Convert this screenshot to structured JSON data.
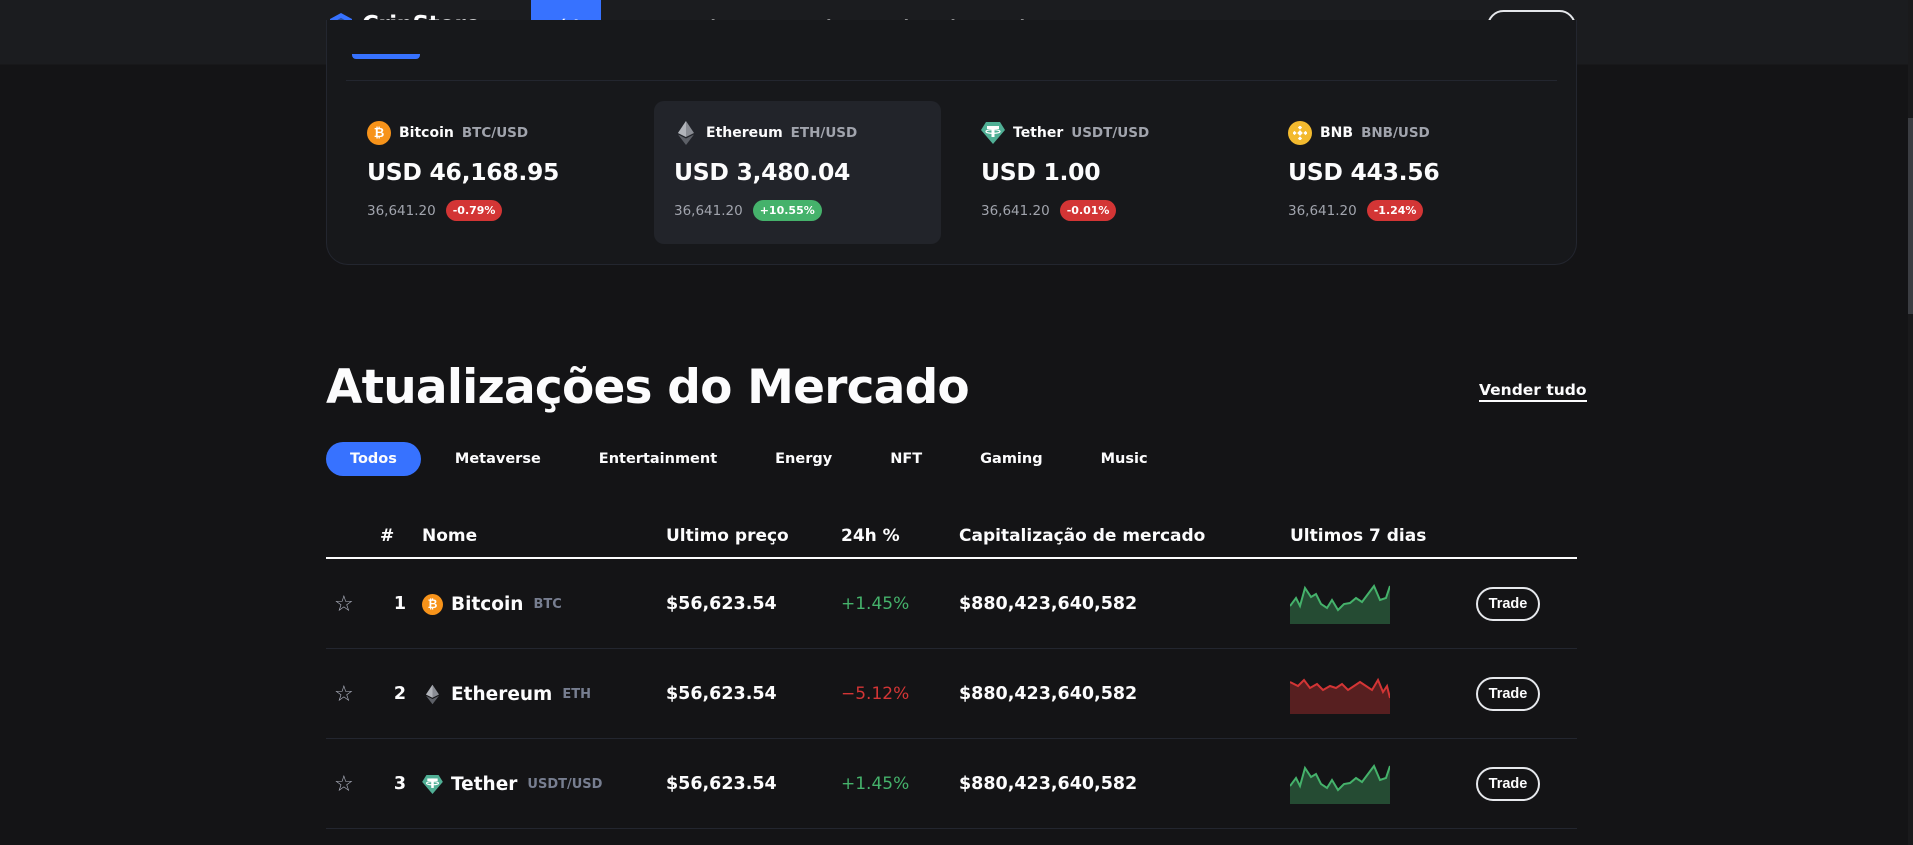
{
  "header": {
    "brand": "CripStore",
    "nav": [
      "Início",
      "Comprar Cripto",
      "Mercado",
      "Vender Cripto",
      "Blog",
      "BITUSDT"
    ],
    "wallet": "Carteira"
  },
  "ticker": [
    {
      "name": "Bitcoin",
      "pair": "BTC/USD",
      "price": "USD 46,168.95",
      "volume": "36,641.20",
      "change": "-0.79%",
      "trend": "neg",
      "icon": "bitcoin-icon"
    },
    {
      "name": "Ethereum",
      "pair": "ETH/USD",
      "price": "USD 3,480.04",
      "volume": "36,641.20",
      "change": "+10.55%",
      "trend": "pos",
      "icon": "ethereum-icon"
    },
    {
      "name": "Tether",
      "pair": "USDT/USD",
      "price": "USD 1.00",
      "volume": "36,641.20",
      "change": "-0.01%",
      "trend": "neg",
      "icon": "tether-icon"
    },
    {
      "name": "BNB",
      "pair": "BNB/USD",
      "price": "USD 443.56",
      "volume": "36,641.20",
      "change": "-1.24%",
      "trend": "neg",
      "icon": "bnb-icon"
    }
  ],
  "market": {
    "title": "Atualizações do Mercado",
    "sell_all": "Vender tudo",
    "tabs": [
      "Todos",
      "Metaverse",
      "Entertainment",
      "Energy",
      "NFT",
      "Gaming",
      "Music"
    ],
    "columns": [
      "#",
      "Nome",
      "Ultimo preço",
      "24h %",
      "Capitalização de mercado",
      "Ultimos 7 dias"
    ],
    "rows": [
      {
        "rank": "1",
        "name": "Bitcoin",
        "symbol": "BTC",
        "price": "$56,623.54",
        "change": "+1.45%",
        "trend": "pos",
        "cap": "$880,423,640,582",
        "action": "Trade"
      },
      {
        "rank": "2",
        "name": "Ethereum",
        "symbol": "ETH",
        "price": "$56,623.54",
        "change": "−5.12%",
        "trend": "neg",
        "cap": "$880,423,640,582",
        "action": "Trade"
      },
      {
        "rank": "3",
        "name": "Tether",
        "symbol": "USDT/USD",
        "price": "$56,623.54",
        "change": "+1.45%",
        "trend": "pos",
        "cap": "$880,423,640,582",
        "action": "Trade"
      }
    ]
  },
  "colors": {
    "accent": "#3772ff",
    "positive": "#45b26b",
    "negative": "#d33535",
    "background": "#141416"
  }
}
